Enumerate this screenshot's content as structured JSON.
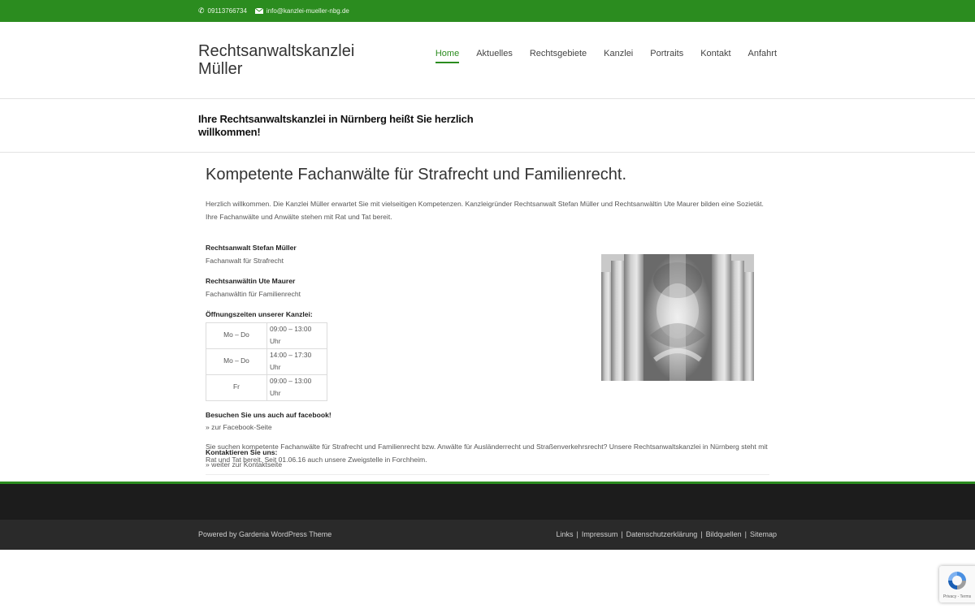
{
  "topbar": {
    "phone": "09113766734",
    "email": "info@kanzlei-mueller-nbg.de"
  },
  "header": {
    "site_title": "Rechtsanwaltskanzlei Müller",
    "nav": [
      {
        "label": "Home",
        "active": true
      },
      {
        "label": "Aktuelles"
      },
      {
        "label": "Rechtsgebiete"
      },
      {
        "label": "Kanzlei"
      },
      {
        "label": "Portraits"
      },
      {
        "label": "Kontakt"
      },
      {
        "label": "Anfahrt"
      }
    ]
  },
  "page_heading": "Ihre Rechtsanwaltskanzlei in Nürnberg heißt Sie herzlich willkommen!",
  "main": {
    "title": "Kompetente Fachanwälte für Strafrecht und Familienrecht.",
    "intro": "Herzlich willkommen. Die Kanzlei Müller erwartet Sie mit vielseitigen Kompetenzen. Kanzleigründer Rechtsanwalt Stefan Müller und Rechtsanwältin Ute Maurer bilden eine Sozietät. Ihre Fachanwälte und Anwälte stehen mit Rat und Tat bereit.",
    "lawyer1_name": "Rechtsanwalt Stefan Müller",
    "lawyer1_title": "Fachanwalt für Strafrecht",
    "lawyer2_name": "Rechtsanwältin Ute Maurer",
    "lawyer2_title": "Fachanwältin für Familienrecht",
    "hours_heading": "Öffnungszeiten unserer Kanzlei:",
    "hours": [
      {
        "day": "Mo – Do",
        "time": "09:00 – 13:00 Uhr"
      },
      {
        "day": "Mo – Do",
        "time": "14:00 – 17:30 Uhr"
      },
      {
        "day": "Fr",
        "time": "09:00 – 13:00 Uhr"
      }
    ],
    "facebook_heading": "Besuchen Sie uns auch auf facebook!",
    "facebook_link": "» zur Facebook-Seite",
    "contact_heading": "Kontaktieren Sie uns:",
    "contact_link": "» weiter zur Kontaktseite",
    "outro": "Sie suchen kompetente Fachanwälte für Strafrecht und Familienrecht bzw. Anwälte für Ausländerrecht und Straßenverkehrsrecht? Unsere Rechtsanwaltskanzlei in Nürnberg steht mit Rat und Tat bereit. Seit 01.06.16 auch unsere Zweigstelle in Forchheim."
  },
  "footer": {
    "powered_by": "Powered by Gardenia WordPress Theme",
    "links": [
      "Links",
      "Impressum",
      "Datenschutzerklärung",
      "Bildquellen",
      "Sitemap"
    ]
  },
  "recaptcha": {
    "caption": "Privacy - Terms"
  },
  "colors": {
    "accent": "#2b8c1f",
    "footer_dark": "#1c1c1c",
    "footer_bottom": "#2a2a2a"
  }
}
